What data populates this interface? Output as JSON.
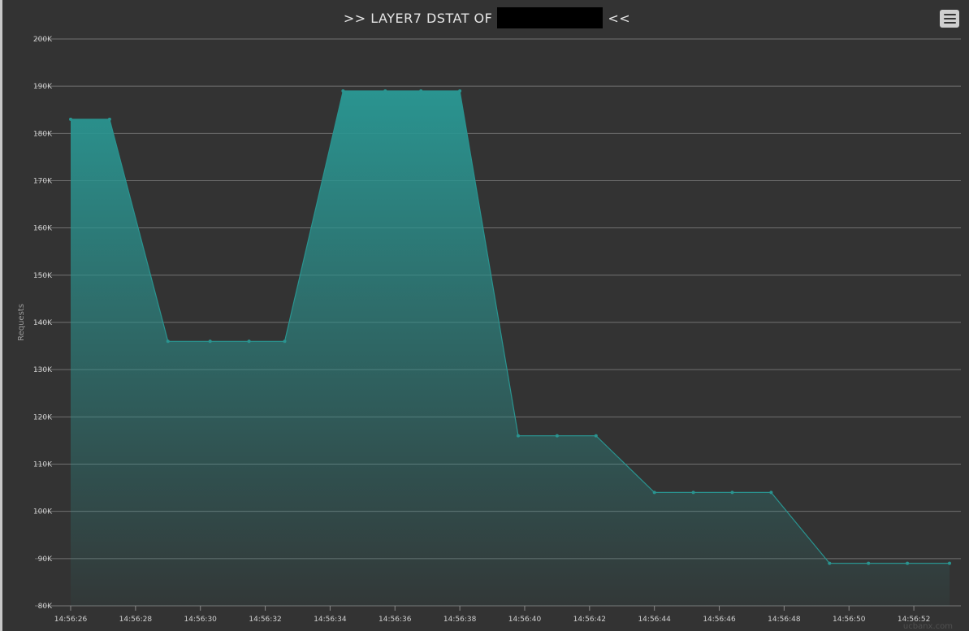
{
  "chart_data": {
    "type": "area",
    "title_prefix": ">> LAYER7 DSTAT OF",
    "title_suffix": "<<",
    "ylabel": "Requests",
    "xlabel": "",
    "ylim": [
      80000,
      200000
    ],
    "y_ticks": [
      80000,
      90000,
      100000,
      110000,
      120000,
      130000,
      140000,
      150000,
      160000,
      170000,
      180000,
      190000,
      200000
    ],
    "y_tick_labels": [
      "80K",
      "90K",
      "100K",
      "110K",
      "120K",
      "130K",
      "140K",
      "150K",
      "160K",
      "170K",
      "180K",
      "190K",
      "200K"
    ],
    "x_tick_labels": [
      "14:56:26",
      "14:56:28",
      "14:56:30",
      "14:56:32",
      "14:56:34",
      "14:56:36",
      "14:56:38",
      "14:56:40",
      "14:56:42",
      "14:56:44",
      "14:56:46",
      "14:56:48",
      "14:56:50",
      "14:56:52"
    ],
    "x_range": [
      "14:56:26",
      "14:56:53.2"
    ],
    "series": [
      {
        "color": "#2a9490",
        "points": [
          {
            "x": "14:56:26.0",
            "y": 183000
          },
          {
            "x": "14:56:27.2",
            "y": 183000
          },
          {
            "x": "14:56:29.0",
            "y": 136000
          },
          {
            "x": "14:56:30.3",
            "y": 136000
          },
          {
            "x": "14:56:31.5",
            "y": 136000
          },
          {
            "x": "14:56:32.6",
            "y": 136000
          },
          {
            "x": "14:56:34.4",
            "y": 189000
          },
          {
            "x": "14:56:35.7",
            "y": 189000
          },
          {
            "x": "14:56:36.8",
            "y": 189000
          },
          {
            "x": "14:56:38.0",
            "y": 189000
          },
          {
            "x": "14:56:39.8",
            "y": 116000
          },
          {
            "x": "14:56:41.0",
            "y": 116000
          },
          {
            "x": "14:56:42.2",
            "y": 116000
          },
          {
            "x": "14:56:44.0",
            "y": 104000
          },
          {
            "x": "14:56:45.2",
            "y": 104000
          },
          {
            "x": "14:56:46.4",
            "y": 104000
          },
          {
            "x": "14:56:47.6",
            "y": 104000
          },
          {
            "x": "14:56:49.4",
            "y": 89000
          },
          {
            "x": "14:56:50.6",
            "y": 89000
          },
          {
            "x": "14:56:51.8",
            "y": 89000
          },
          {
            "x": "14:56:53.1",
            "y": 89000
          }
        ]
      }
    ],
    "grid": true,
    "legend": "none"
  },
  "credits": "ucbanx.com"
}
